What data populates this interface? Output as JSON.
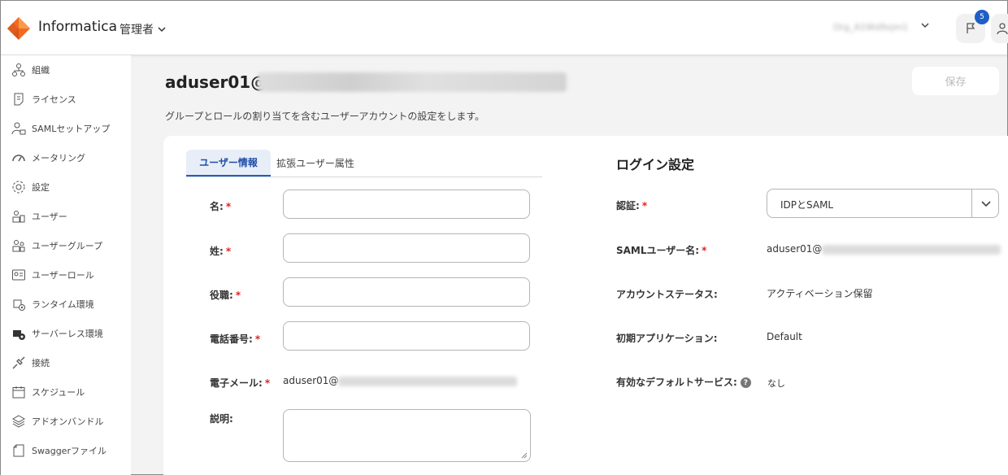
{
  "header": {
    "brand": "Informatica",
    "role_menu": "管理者",
    "org_name": "Org_A1Wd9xjm1",
    "notifications_count": "5"
  },
  "sidebar": {
    "items": [
      {
        "label": "組織",
        "icon": "organization-icon"
      },
      {
        "label": "ライセンス",
        "icon": "license-icon"
      },
      {
        "label": "SAMLセットアップ",
        "icon": "saml-setup-icon"
      },
      {
        "label": "メータリング",
        "icon": "metering-icon"
      },
      {
        "label": "設定",
        "icon": "settings-icon"
      },
      {
        "label": "ユーザー",
        "icon": "users-icon"
      },
      {
        "label": "ユーザーグループ",
        "icon": "user-groups-icon"
      },
      {
        "label": "ユーザーロール",
        "icon": "user-roles-icon"
      },
      {
        "label": "ランタイム環境",
        "icon": "runtime-environment-icon"
      },
      {
        "label": "サーバーレス環境",
        "icon": "serverless-environment-icon"
      },
      {
        "label": "接続",
        "icon": "connections-icon"
      },
      {
        "label": "スケジュール",
        "icon": "schedule-icon"
      },
      {
        "label": "アドオンバンドル",
        "icon": "addon-bundle-icon"
      },
      {
        "label": "Swaggerファイル",
        "icon": "swagger-file-icon"
      }
    ]
  },
  "page": {
    "title": "aduser01@",
    "subtitle": "グループとロールの割り当てを含むユーザーアカウントの設定をします。",
    "save_label": "保存"
  },
  "tabs": {
    "user_info": "ユーザー情報",
    "extended_attributes": "拡張ユーザー属性"
  },
  "form": {
    "first_name_label": "名:",
    "last_name_label": "姓:",
    "job_title_label": "役職:",
    "phone_label": "電話番号:",
    "email_label": "電子メール:",
    "email_value": "aduser01@",
    "description_label": "説明:",
    "required_mark": "*"
  },
  "login": {
    "title": "ログイン設定",
    "auth_label": "認証:",
    "auth_value": "IDPとSAML",
    "saml_user_label": "SAMLユーザー名:",
    "saml_user_value": "aduser01@",
    "account_status_label": "アカウントステータス:",
    "account_status_value": "アクティベーション保留",
    "initial_app_label": "初期アプリケーション:",
    "initial_app_value": "Default",
    "default_service_label": "有効なデフォルトサービス:",
    "default_service_value": "なし"
  },
  "colors": {
    "accent": "#1f5fc4",
    "required": "#dd2222",
    "logo_orange": "#f26b21"
  }
}
